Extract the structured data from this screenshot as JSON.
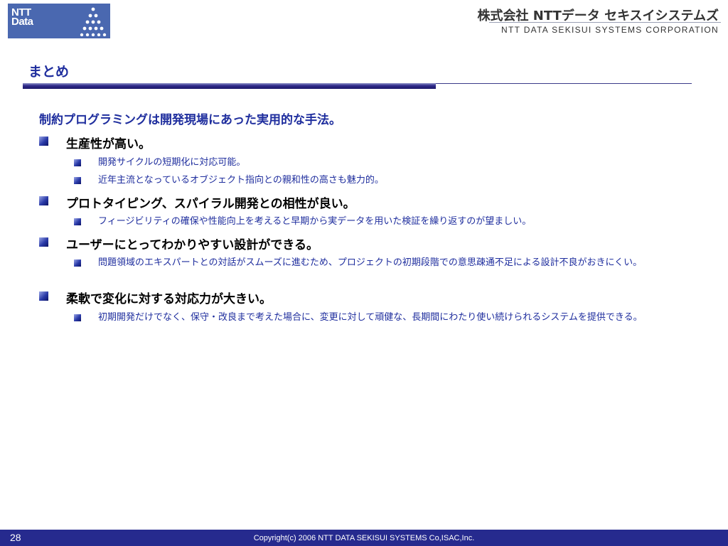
{
  "header": {
    "logo_text_line1": "NTT",
    "logo_text_line2": "Data",
    "company_jp": "株式会社 NTTデータ セキスイシステムズ",
    "company_en": "NTT DATA SEKISUI SYSTEMS CORPORATION",
    "logo_color": "#4a68b0"
  },
  "title": "まとめ",
  "intro": "制約プログラミングは開発現場にあった実用的な手法。",
  "sections": [
    {
      "heading": "生産性が高い。",
      "items": [
        "開発サイクルの短期化に対応可能。",
        "近年主流となっているオブジェクト指向との親和性の高さも魅力的。"
      ]
    },
    {
      "heading": "プロトタイピング、スパイラル開発との相性が良い。",
      "items": [
        "フィージビリティの確保や性能向上を考えると早期から実データを用いた検証を繰り返すのが望ましい。"
      ]
    },
    {
      "heading": "ユーザーにとってわかりやすい設計ができる。",
      "items": [
        "問題領域のエキスパートとの対話がスムーズに進むため、プロジェクトの初期段階での意思疎通不足による設計不良がおきにくい。"
      ]
    },
    {
      "heading": "柔軟で変化に対する対応力が大きい。",
      "items": [
        "初期開発だけでなく、保守・改良まで考えた場合に、変更に対して頑健な、長期間にわたり使い続けられるシステムを提供できる。"
      ]
    }
  ],
  "footer": {
    "page_number": "28",
    "copyright": "Copyright(c) 2006 NTT DATA SEKISUI SYSTEMS Co,ISAC,Inc.",
    "bar_color": "#262a8e"
  },
  "colors": {
    "accent_blue": "#1f2e9e",
    "bullet": "#2a3aa8"
  }
}
